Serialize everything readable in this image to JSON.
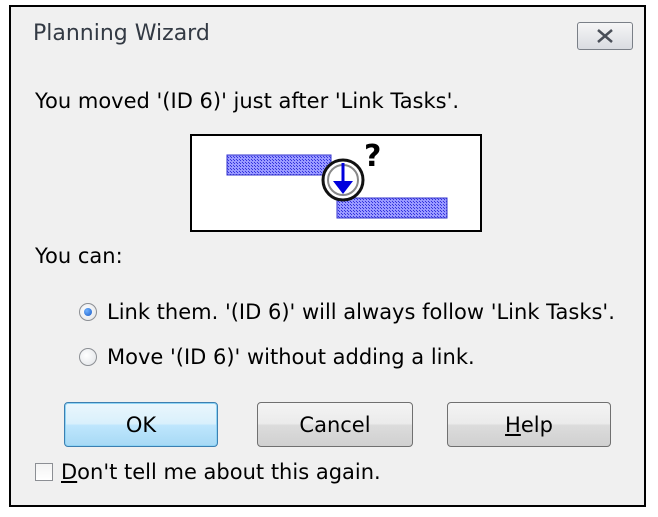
{
  "dialog": {
    "title": "Planning Wizard",
    "message": "You moved '(ID 6)' just after 'Link Tasks'.",
    "illustration_icon": "link-tasks-question-illustration",
    "you_can_label": "You can:",
    "options": [
      {
        "label": "Link them. '(ID 6)' will always follow 'Link Tasks'.",
        "selected": true
      },
      {
        "label": "Move '(ID 6)' without adding a link.",
        "selected": false
      }
    ],
    "buttons": {
      "ok": "OK",
      "cancel": "Cancel",
      "help_first": "H",
      "help_rest": "elp"
    },
    "checkbox": {
      "first": "D",
      "rest": "on't tell me about this again.",
      "checked": false
    }
  },
  "colors": {
    "window_bg": "#f0f0f0",
    "default_button": "#bee6fd",
    "task_bar": "#6666ee"
  }
}
